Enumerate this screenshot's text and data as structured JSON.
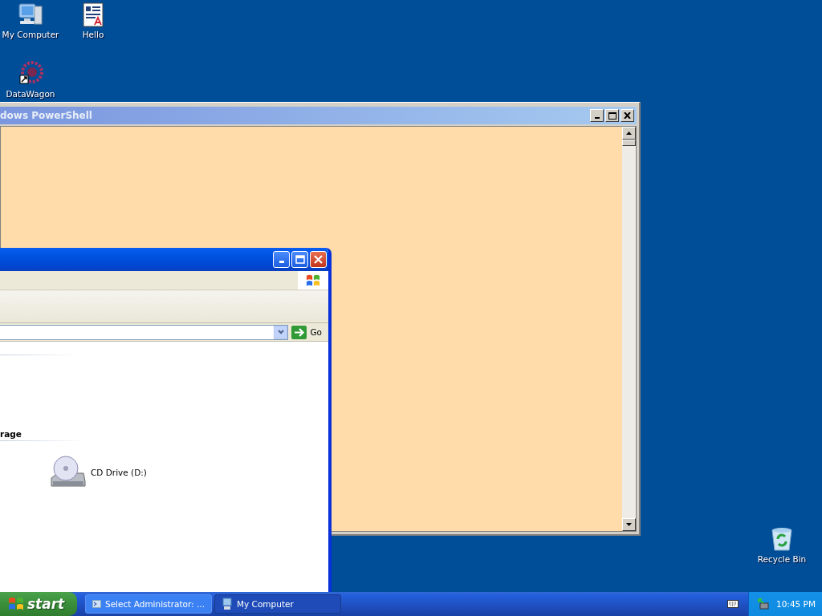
{
  "desktop_icons": [
    {
      "label": "My Computer",
      "kind": "computer"
    },
    {
      "label": "Hello",
      "kind": "document"
    },
    {
      "label": "DataWagon",
      "kind": "shortcut"
    },
    {
      "label": "Recycle Bin",
      "kind": "recycle"
    }
  ],
  "powershell_window": {
    "title": "dows PowerShell",
    "active": false
  },
  "explorer_window": {
    "active": true,
    "go_label": "Go",
    "sections": [
      {
        "heading": "rage",
        "items": [
          {
            "label": "CD Drive (D:)"
          }
        ]
      }
    ]
  },
  "taskbar": {
    "start_label": "start",
    "tasks": [
      {
        "label": "Select Administrator: ...",
        "selected": false,
        "kind": "powershell"
      },
      {
        "label": "My Computer",
        "selected": true,
        "kind": "computer"
      }
    ],
    "clock": "10:45 PM"
  }
}
